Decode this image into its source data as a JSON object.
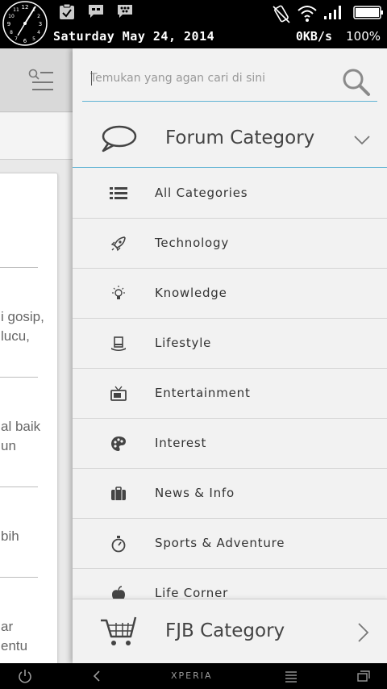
{
  "status_bar": {
    "clock_icon": "analog-clock-icon",
    "notification_icons": [
      "checked-clipboard-icon",
      "bbm-chat-icon",
      "blackberry-icon"
    ],
    "system_icons": [
      "vibrate-icon",
      "wifi-icon",
      "signal-icon",
      "battery-icon"
    ],
    "date": "Saturday May 24, 2014",
    "net_speed": "0KB/s",
    "battery_percent": "100%"
  },
  "background_page": {
    "menu_icon": "search-menu-icon",
    "snippets": [
      "i gosip,",
      "lucu,",
      "al baik",
      "un",
      "bih",
      "ar",
      "entu"
    ]
  },
  "drawer": {
    "search": {
      "placeholder": "Temukan yang agan cari di sini",
      "icon": "search-icon"
    },
    "forum_category": {
      "title": "Forum Category",
      "icon": "chat-bubble-icon",
      "chevron": "chevron-down-icon"
    },
    "categories": [
      {
        "label": "All Categories",
        "icon": "list-icon"
      },
      {
        "label": "Technology",
        "icon": "rocket-icon"
      },
      {
        "label": "Knowledge",
        "icon": "lightbulb-icon"
      },
      {
        "label": "Lifestyle",
        "icon": "top-hat-icon"
      },
      {
        "label": "Entertainment",
        "icon": "tv-icon"
      },
      {
        "label": "Interest",
        "icon": "palette-icon"
      },
      {
        "label": "News & Info",
        "icon": "briefcase-icon"
      },
      {
        "label": "Sports & Adventure",
        "icon": "stopwatch-icon"
      },
      {
        "label": "Life Corner",
        "icon": "apple-icon"
      }
    ],
    "fjb_category": {
      "title": "FJB Category",
      "icon": "shopping-cart-icon",
      "chevron": "chevron-right-icon"
    }
  },
  "nav_bar": {
    "brand": "XPERIA",
    "buttons": [
      "power-icon",
      "back-icon",
      "home-icon",
      "recent-apps-icon"
    ]
  }
}
